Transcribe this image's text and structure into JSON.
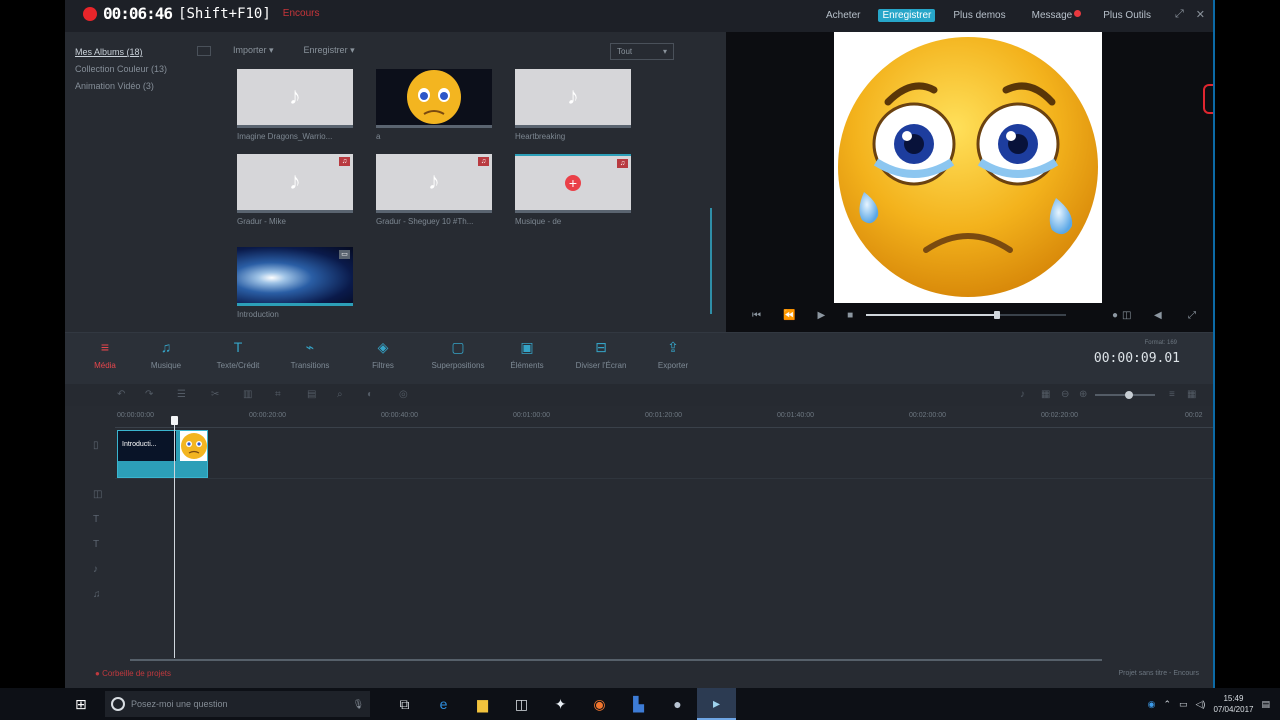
{
  "recorder": {
    "time": "00:06:46",
    "hint": "[Shift+F10]",
    "label": "Encours"
  },
  "topmenu": {
    "items": [
      "Acheter",
      "Enregistrer",
      "Plus demos",
      "Message",
      "Plus Outils"
    ],
    "active_index": 1
  },
  "library": {
    "sidebar": [
      "Mes Albums (18)",
      "Collection Couleur (13)",
      "Animation Vidéo (3)"
    ],
    "import_label": "Importer",
    "record_label": "Enregistrer",
    "sort_value": "Tout",
    "items": [
      {
        "label": "Imagine Dragons_Warrio...",
        "kind": "audio"
      },
      {
        "label": "a",
        "kind": "image"
      },
      {
        "label": "Heartbreaking",
        "kind": "audio"
      },
      {
        "label": "Gradur - Mike",
        "kind": "audio"
      },
      {
        "label": "Gradur - Sheguey 10 #Th...",
        "kind": "audio"
      },
      {
        "label": "Musique - de",
        "kind": "audio"
      },
      {
        "label": "Introduction",
        "kind": "video"
      }
    ]
  },
  "toolbar": {
    "tools": [
      {
        "label": "Média",
        "icon": "media-icon"
      },
      {
        "label": "Musique",
        "icon": "music-icon"
      },
      {
        "label": "Texte/Crédit",
        "icon": "text-icon"
      },
      {
        "label": "Transitions",
        "icon": "transitions-icon"
      },
      {
        "label": "Filtres",
        "icon": "filters-icon"
      },
      {
        "label": "Superpositions",
        "icon": "overlays-icon"
      },
      {
        "label": "Éléments",
        "icon": "elements-icon"
      },
      {
        "label": "Diviser l'Écran",
        "icon": "split-screen-icon"
      },
      {
        "label": "Exporter",
        "icon": "export-icon"
      }
    ],
    "timecode": "00:00:09.01",
    "timecode_small": "Format: 169"
  },
  "timeline": {
    "ruler": [
      "00:00:00:00",
      "00:00:20:00",
      "00:00:40:00",
      "00:01:00:00",
      "00:01:20:00",
      "00:01:40:00",
      "00:02:00:00",
      "00:02:20:00",
      "00:02"
    ],
    "clip_label": "Introducti...",
    "status_left": "Corbeille de projets",
    "status_right": "Projet sans titre - Encours"
  },
  "taskbar": {
    "search_placeholder": "Posez-moi une question",
    "time": "15:49",
    "date": "07/04/2017"
  },
  "colors": {
    "accent": "#27a6c9",
    "record": "#e8252a",
    "bg": "#272b32"
  }
}
